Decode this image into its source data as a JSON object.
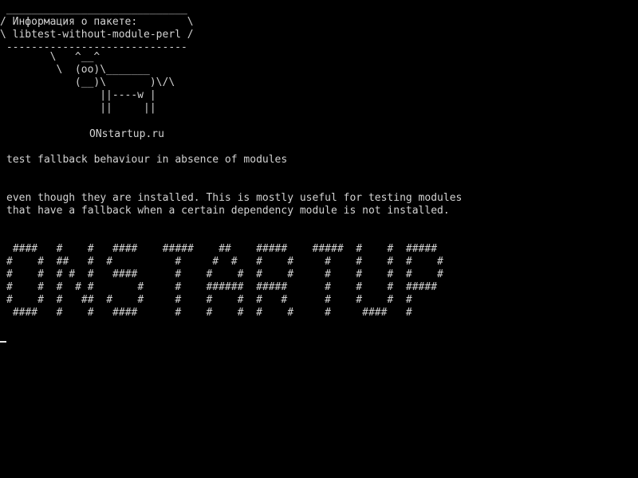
{
  "speech_bubble": {
    "lines": [
      " _____________________________",
      "/ Информация о пакете:        \\",
      "\\ libtest-without-module-perl /",
      " -----------------------------"
    ]
  },
  "cow": {
    "lines": [
      "        \\   ^__^",
      "         \\  (oo)\\_______",
      "            (__)\\       )\\/\\",
      "                ||----w |",
      "                ||     ||"
    ],
    "site": "ONstartup.ru"
  },
  "package": {
    "summary": "test fallback behaviour in absence of modules",
    "description_lines": [
      "even though they are installed. This is mostly useful for testing modules",
      "that have a fallback when a certain dependency module is not installed."
    ]
  },
  "banner": {
    "lines": [
      " ####   #    #   ####    #####    ##    #####    #####  #    #  #####",
      "#    #  ##   #  #          #     #  #   #    #     #    #    #  #    #",
      "#    #  # #  #   ####      #    #    #  #    #     #    #    #  #    #",
      "#    #  #  # #       #     #    ######  #####      #    #    #  #####",
      "#    #  #   ##  #    #     #    #    #  #   #      #    #    #  #",
      " ####   #    #   ####      #    #    #  #    #     #     ####   #"
    ]
  },
  "terminal": {
    "background": "#000000",
    "foreground": "#d2d2d2"
  }
}
